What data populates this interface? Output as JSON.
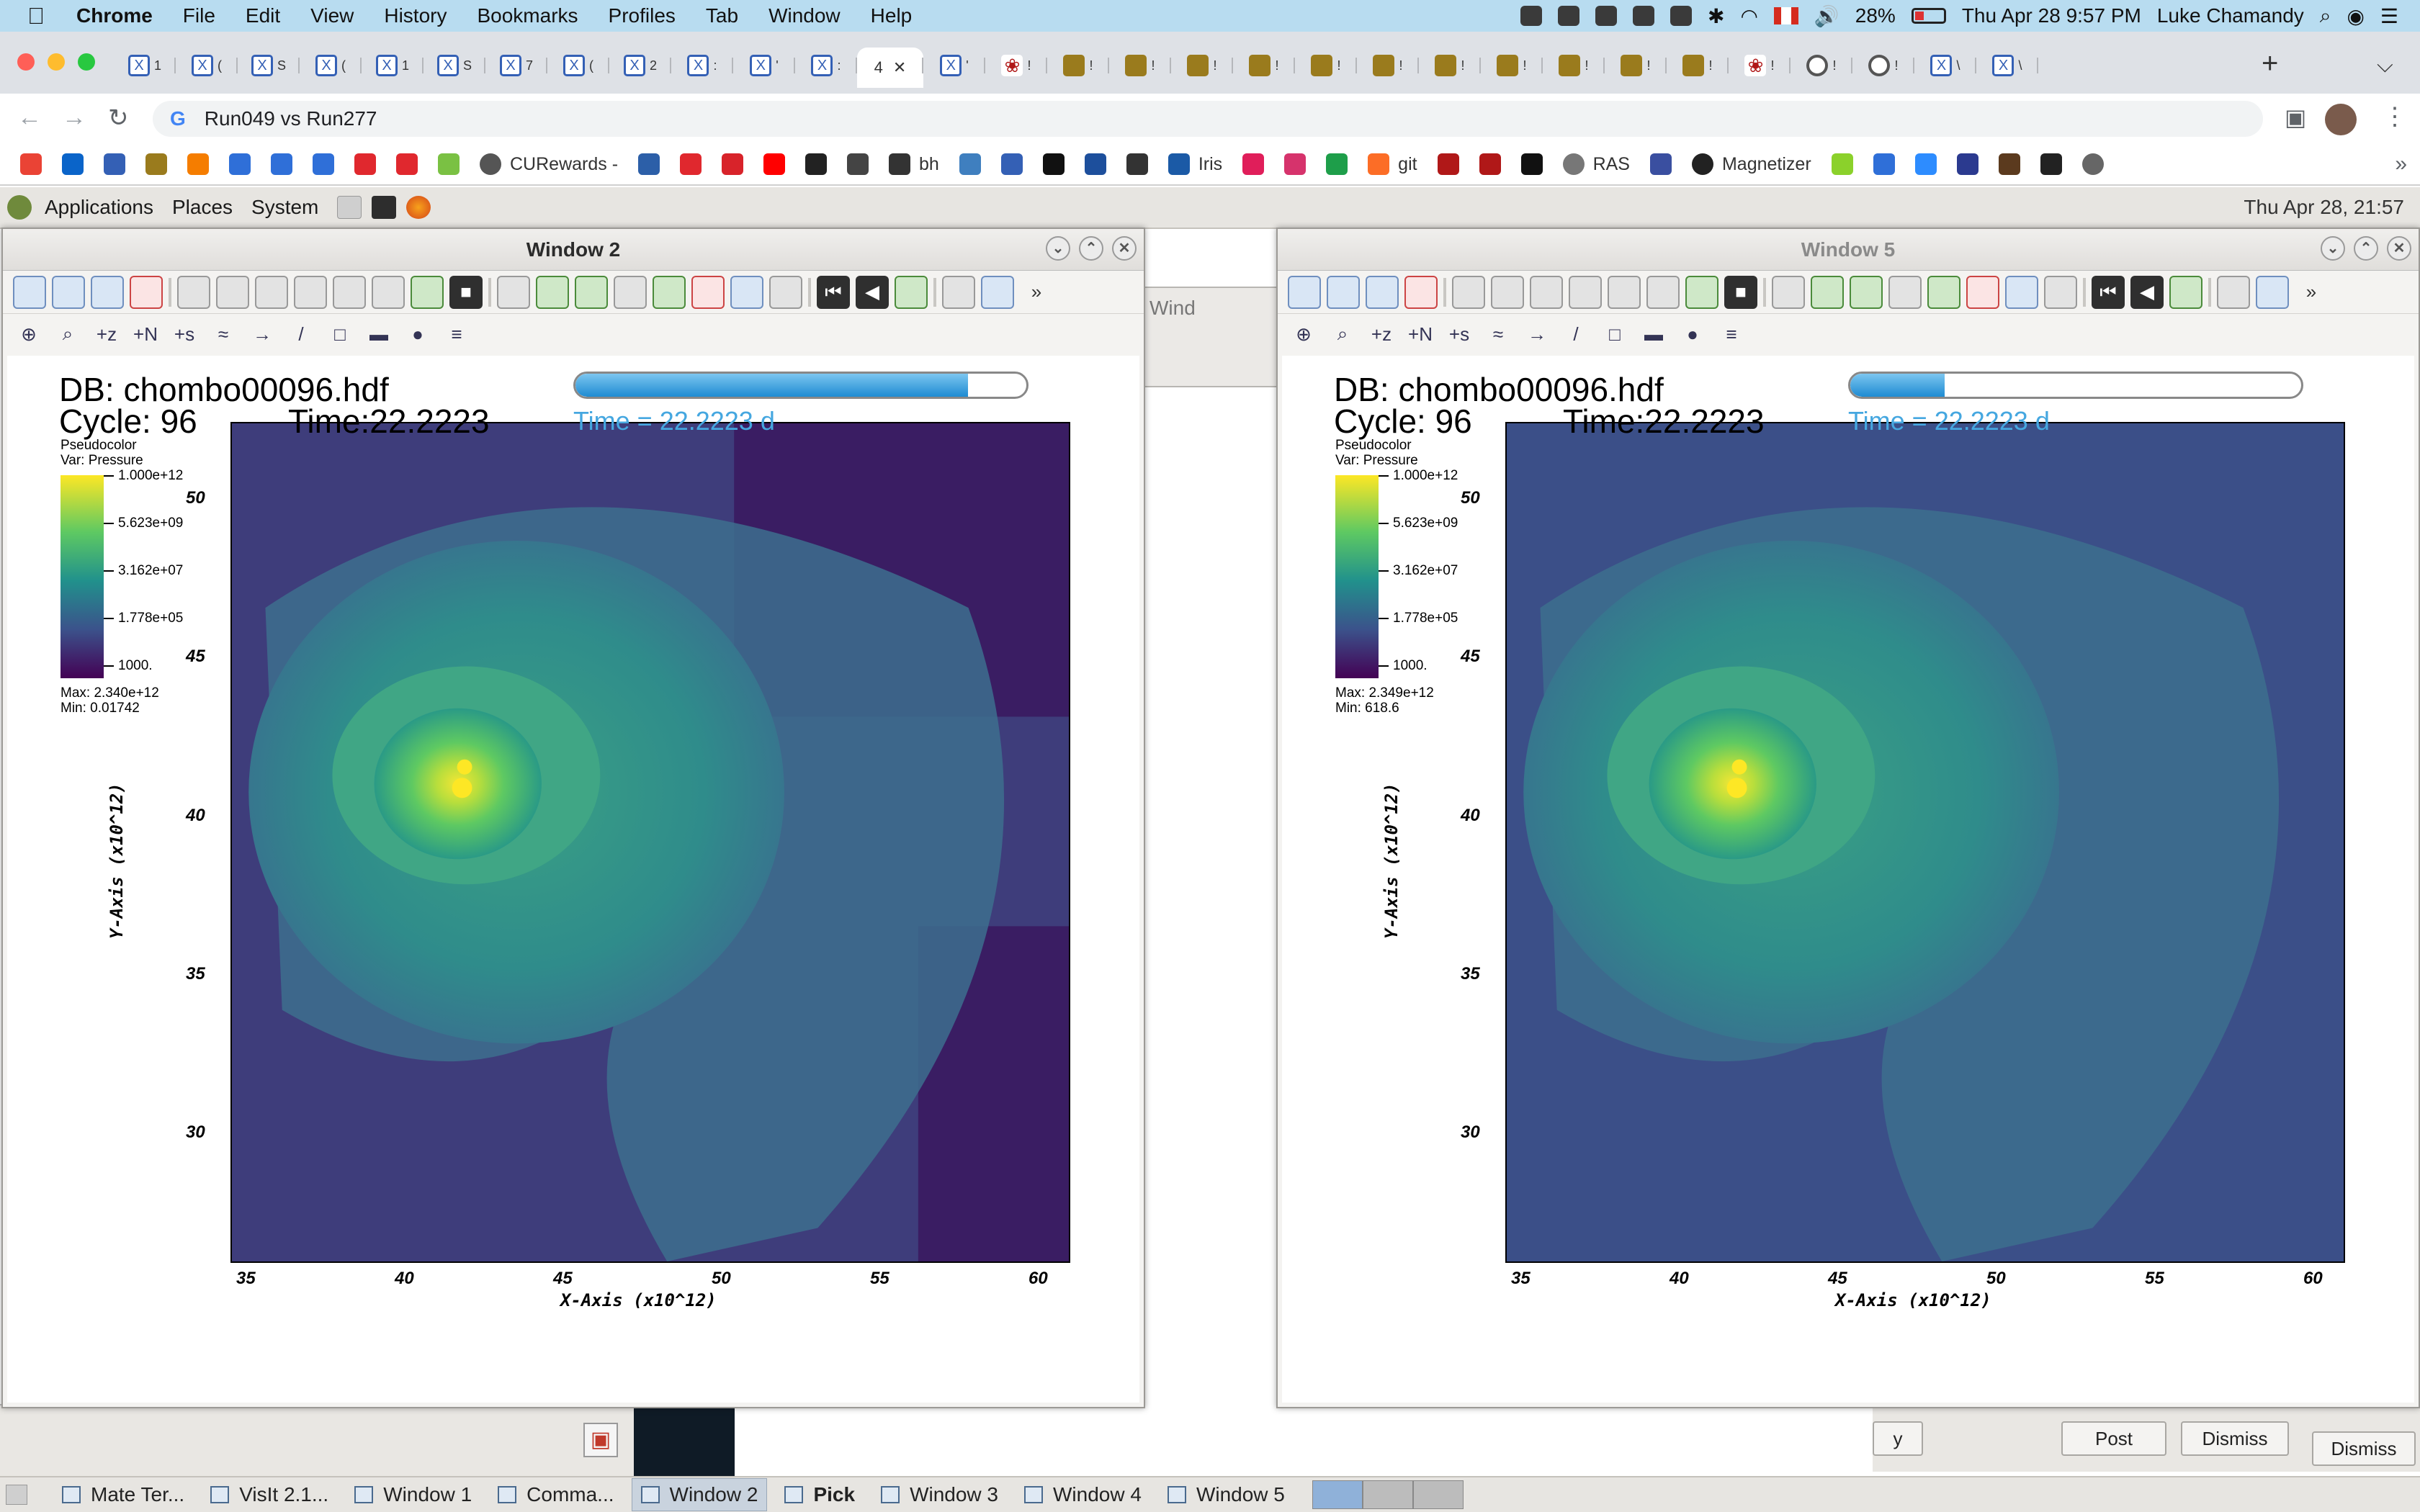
{
  "mac_menubar": {
    "apple": "",
    "items": [
      "Chrome",
      "File",
      "Edit",
      "View",
      "History",
      "Bookmarks",
      "Profiles",
      "Tab",
      "Window",
      "Help"
    ],
    "battery": "28%",
    "datetime": "Thu Apr 28  9:57 PM",
    "user": "Luke Chamandy"
  },
  "chrome": {
    "active_tab_label": "4",
    "tabs": [
      {
        "icon": "x",
        "label": "1"
      },
      {
        "icon": "x",
        "label": "("
      },
      {
        "icon": "x",
        "label": "S"
      },
      {
        "icon": "x",
        "label": "("
      },
      {
        "icon": "x",
        "label": "1"
      },
      {
        "icon": "x",
        "label": "S"
      },
      {
        "icon": "x",
        "label": "7"
      },
      {
        "icon": "x",
        "label": "("
      },
      {
        "icon": "x",
        "label": "2"
      },
      {
        "icon": "x",
        "label": ":"
      },
      {
        "icon": "x",
        "label": "'"
      },
      {
        "icon": "x",
        "label": ":"
      },
      {
        "icon": "active",
        "label": "4"
      },
      {
        "icon": "x",
        "label": "'"
      },
      {
        "icon": "paw",
        "label": "!"
      },
      {
        "icon": "sun",
        "label": "!"
      },
      {
        "icon": "sun",
        "label": "!"
      },
      {
        "icon": "sun",
        "label": "!"
      },
      {
        "icon": "sun",
        "label": "!"
      },
      {
        "icon": "sun",
        "label": "!"
      },
      {
        "icon": "sun",
        "label": "!"
      },
      {
        "icon": "sun",
        "label": "!"
      },
      {
        "icon": "sun",
        "label": "!"
      },
      {
        "icon": "sun",
        "label": "!"
      },
      {
        "icon": "sun",
        "label": "!"
      },
      {
        "icon": "sun",
        "label": "!"
      },
      {
        "icon": "paw",
        "label": "!"
      },
      {
        "icon": "gh",
        "label": "!"
      },
      {
        "icon": "gh",
        "label": "!"
      },
      {
        "icon": "x",
        "label": "\\"
      },
      {
        "icon": "x",
        "label": "\\"
      }
    ],
    "new_tab": "+",
    "url": "Run049 vs Run277",
    "bookmarks": [
      {
        "icon": "gmail",
        "label": ""
      },
      {
        "icon": "outlook",
        "label": ""
      },
      {
        "icon": "x",
        "label": ""
      },
      {
        "icon": "sun",
        "label": ""
      },
      {
        "icon": "blogger",
        "label": ""
      },
      {
        "icon": "a",
        "label": ""
      },
      {
        "icon": "a",
        "label": ""
      },
      {
        "icon": "a",
        "label": ""
      },
      {
        "icon": "tsn",
        "label": ""
      },
      {
        "icon": "ads",
        "label": ""
      },
      {
        "icon": "m",
        "label": ""
      },
      {
        "icon": "cu",
        "label": "CURewards -"
      },
      {
        "icon": "blue",
        "label": ""
      },
      {
        "icon": "tsn",
        "label": ""
      },
      {
        "icon": "cbc",
        "label": ""
      },
      {
        "icon": "yt",
        "label": ""
      },
      {
        "icon": "qr",
        "label": ""
      },
      {
        "icon": "qr2",
        "label": ""
      },
      {
        "icon": "book",
        "label": "bh"
      },
      {
        "icon": "cloud",
        "label": ""
      },
      {
        "icon": "x",
        "label": ""
      },
      {
        "icon": "nb",
        "label": ""
      },
      {
        "icon": "star",
        "label": ""
      },
      {
        "icon": "gear",
        "label": ""
      },
      {
        "icon": "iris",
        "label": "Iris"
      },
      {
        "icon": "slack",
        "label": ""
      },
      {
        "icon": "star2",
        "label": ""
      },
      {
        "icon": "plus",
        "label": ""
      },
      {
        "icon": "gitlab",
        "label": "git"
      },
      {
        "icon": "paw",
        "label": ""
      },
      {
        "icon": "paw",
        "label": ""
      },
      {
        "icon": "kiwi",
        "label": ""
      },
      {
        "icon": "ras",
        "label": "RAS"
      },
      {
        "icon": "cal",
        "label": ""
      },
      {
        "icon": "github",
        "label": "Magnetizer"
      },
      {
        "icon": "smile",
        "label": ""
      },
      {
        "icon": "a",
        "label": ""
      },
      {
        "icon": "zoom",
        "label": ""
      },
      {
        "icon": "doc",
        "label": ""
      },
      {
        "icon": "coffee",
        "label": ""
      },
      {
        "icon": "s",
        "label": ""
      },
      {
        "icon": "translate",
        "label": ""
      }
    ]
  },
  "gnome": {
    "menus": [
      "Applications",
      "Places",
      "System"
    ],
    "clock": "Thu Apr 28, 21:57",
    "tasks": [
      {
        "label": "Mate Ter...",
        "active": false,
        "bold": false
      },
      {
        "label": "VisIt 2.1...",
        "active": false,
        "bold": false
      },
      {
        "label": "Window 1",
        "active": false,
        "bold": false
      },
      {
        "label": "Comma...",
        "active": false,
        "bold": false
      },
      {
        "label": "Window 2",
        "active": true,
        "bold": false
      },
      {
        "label": "Pick",
        "active": false,
        "bold": true
      },
      {
        "label": "Window 3",
        "active": false,
        "bold": false
      },
      {
        "label": "Window 4",
        "active": false,
        "bold": false
      },
      {
        "label": "Window 5",
        "active": false,
        "bold": false
      }
    ]
  },
  "background_windows": {
    "behind_title": "Wind",
    "post_label": "Post",
    "dismiss_label": "Dismiss",
    "dismiss2_label": "Dismiss",
    "y_label": "y"
  },
  "windows": [
    {
      "title": "Window 2",
      "active": true,
      "db": "DB: chombo00096.hdf",
      "cycle": "Cycle: 96",
      "time_text": "Time:22.2223",
      "time_days": "Time = 22.2223 d",
      "progress": 0.87,
      "legend": {
        "plot_type": "Pseudocolor",
        "var": "Var: Pressure",
        "ticks": [
          "1.000e+12",
          "5.623e+09",
          "3.162e+07",
          "1.778e+05",
          "1000."
        ],
        "max": "Max:  2.340e+12",
        "min": "Min:  0.01742"
      }
    },
    {
      "title": "Window 5",
      "active": false,
      "db": "DB: chombo00096.hdf",
      "cycle": "Cycle: 96",
      "time_text": "Time:22.2223",
      "time_days": "Time = 22.2223 d",
      "progress": 0.21,
      "legend": {
        "plot_type": "Pseudocolor",
        "var": "Var: Pressure",
        "ticks": [
          "1.000e+12",
          "5.623e+09",
          "3.162e+07",
          "1.778e+05",
          "1000."
        ],
        "max": "Max:  2.349e+12",
        "min": "Min:  618.6"
      }
    }
  ],
  "axes": {
    "x_ticks": [
      "35",
      "40",
      "45",
      "50",
      "55",
      "60"
    ],
    "y_ticks": [
      "50",
      "45",
      "40",
      "35",
      "30"
    ],
    "x_label": "X-Axis (x10^12)",
    "y_label": "Y-Axis (x10^12)",
    "xlim": [
      34.5,
      61
    ],
    "ylim": [
      25.9,
      52.4
    ]
  },
  "colors": {
    "viridis_top": "#fde725",
    "viridis_bottom": "#440154",
    "time_label": "#45a7e0",
    "progress_fill": "#1e8bd2"
  }
}
